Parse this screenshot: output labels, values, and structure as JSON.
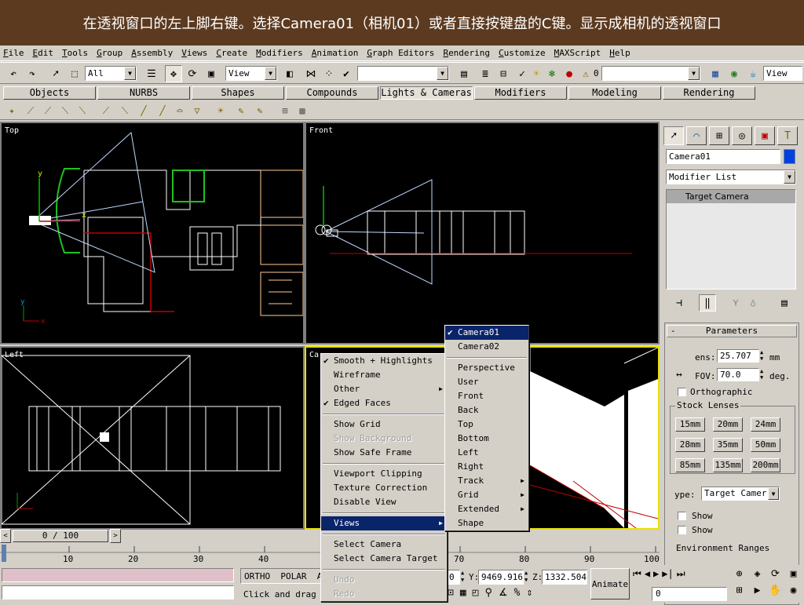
{
  "banner": {
    "text": "在透视窗口的左上脚右键。选择Camera01（相机01）或者直接按键盘的C键。显示成相机的透视窗口"
  },
  "menubar": [
    "File",
    "Edit",
    "Tools",
    "Group",
    "Assembly",
    "Views",
    "Create",
    "Modifiers",
    "Animation",
    "Graph Editors",
    "Rendering",
    "Customize",
    "MAXScript",
    "Help"
  ],
  "toolbar": {
    "selection_filter": "All",
    "coord_system": "View",
    "named_selection": "",
    "layer": "0",
    "render_view": "View"
  },
  "tabs": [
    "Objects",
    "NURBS",
    "Shapes",
    "Compounds",
    "Lights & Cameras",
    "Modifiers",
    "Modeling",
    "Rendering"
  ],
  "active_tab": "Lights & Cameras",
  "viewports": {
    "top": "Top",
    "front": "Front",
    "left": "Left",
    "camera": "Ca"
  },
  "context_menu": {
    "items": [
      {
        "label": "Smooth + Highlights",
        "checked": true
      },
      {
        "label": "Wireframe"
      },
      {
        "label": "Other",
        "submenu": true
      },
      {
        "label": "Edged Faces",
        "checked": true
      },
      {
        "sep": true
      },
      {
        "label": "Show Grid"
      },
      {
        "label": "Show Background",
        "disabled": true
      },
      {
        "label": "Show Safe Frame"
      },
      {
        "sep": true
      },
      {
        "label": "Viewport Clipping"
      },
      {
        "label": "Texture Correction"
      },
      {
        "label": "Disable View"
      },
      {
        "sep": true
      },
      {
        "label": "Views",
        "submenu": true,
        "selected": true
      },
      {
        "sep": true
      },
      {
        "label": "Select Camera"
      },
      {
        "label": "Select Camera Target"
      },
      {
        "sep": true
      },
      {
        "label": "Undo",
        "disabled": true
      },
      {
        "label": "Redo",
        "disabled": true
      }
    ]
  },
  "views_submenu": {
    "items": [
      {
        "label": "Camera01",
        "checked": true,
        "selected": true
      },
      {
        "label": "Camera02"
      },
      {
        "sep": true
      },
      {
        "label": "Perspective"
      },
      {
        "label": "User"
      },
      {
        "label": "Front"
      },
      {
        "label": "Back"
      },
      {
        "label": "Top"
      },
      {
        "label": "Bottom"
      },
      {
        "label": "Left"
      },
      {
        "label": "Right"
      },
      {
        "label": "Track",
        "submenu": true
      },
      {
        "label": "Grid",
        "submenu": true
      },
      {
        "label": "Extended",
        "submenu": true
      },
      {
        "label": "Shape"
      }
    ]
  },
  "command_panel": {
    "object_name": "Camera01",
    "modifier_list": "Modifier List",
    "stack_item": "Target Camera",
    "parameters_title": "Parameters",
    "lens_label": "ens:",
    "lens_value": "25.707",
    "lens_unit": "mm",
    "fov_label": "FOV:",
    "fov_value": "70.0",
    "fov_unit": "deg.",
    "orthographic": "Orthographic",
    "stock_lenses_title": "Stock Lenses",
    "lenses": [
      "15mm",
      "20mm",
      "24mm",
      "28mm",
      "35mm",
      "50mm",
      "85mm",
      "135mm",
      "200mm"
    ],
    "type_label": "ype:",
    "type_value": "Target Camer",
    "show1": "Show",
    "show2": "Show",
    "env_ranges": "Environment Ranges"
  },
  "timeline": {
    "frame": "0 / 100",
    "ticks": [
      "10",
      "20",
      "30",
      "40",
      "70",
      "80",
      "90",
      "100"
    ]
  },
  "status": {
    "ortho": "ORTHO",
    "polar": "POLAR",
    "snap_extra": "A",
    "prompt": "Click and drag",
    "x_value": "0",
    "y_label": "Y:",
    "y_value": "9469.916",
    "z_label": "Z:",
    "z_value": "1332.504",
    "animate": "Animate",
    "frame_field": "0"
  }
}
